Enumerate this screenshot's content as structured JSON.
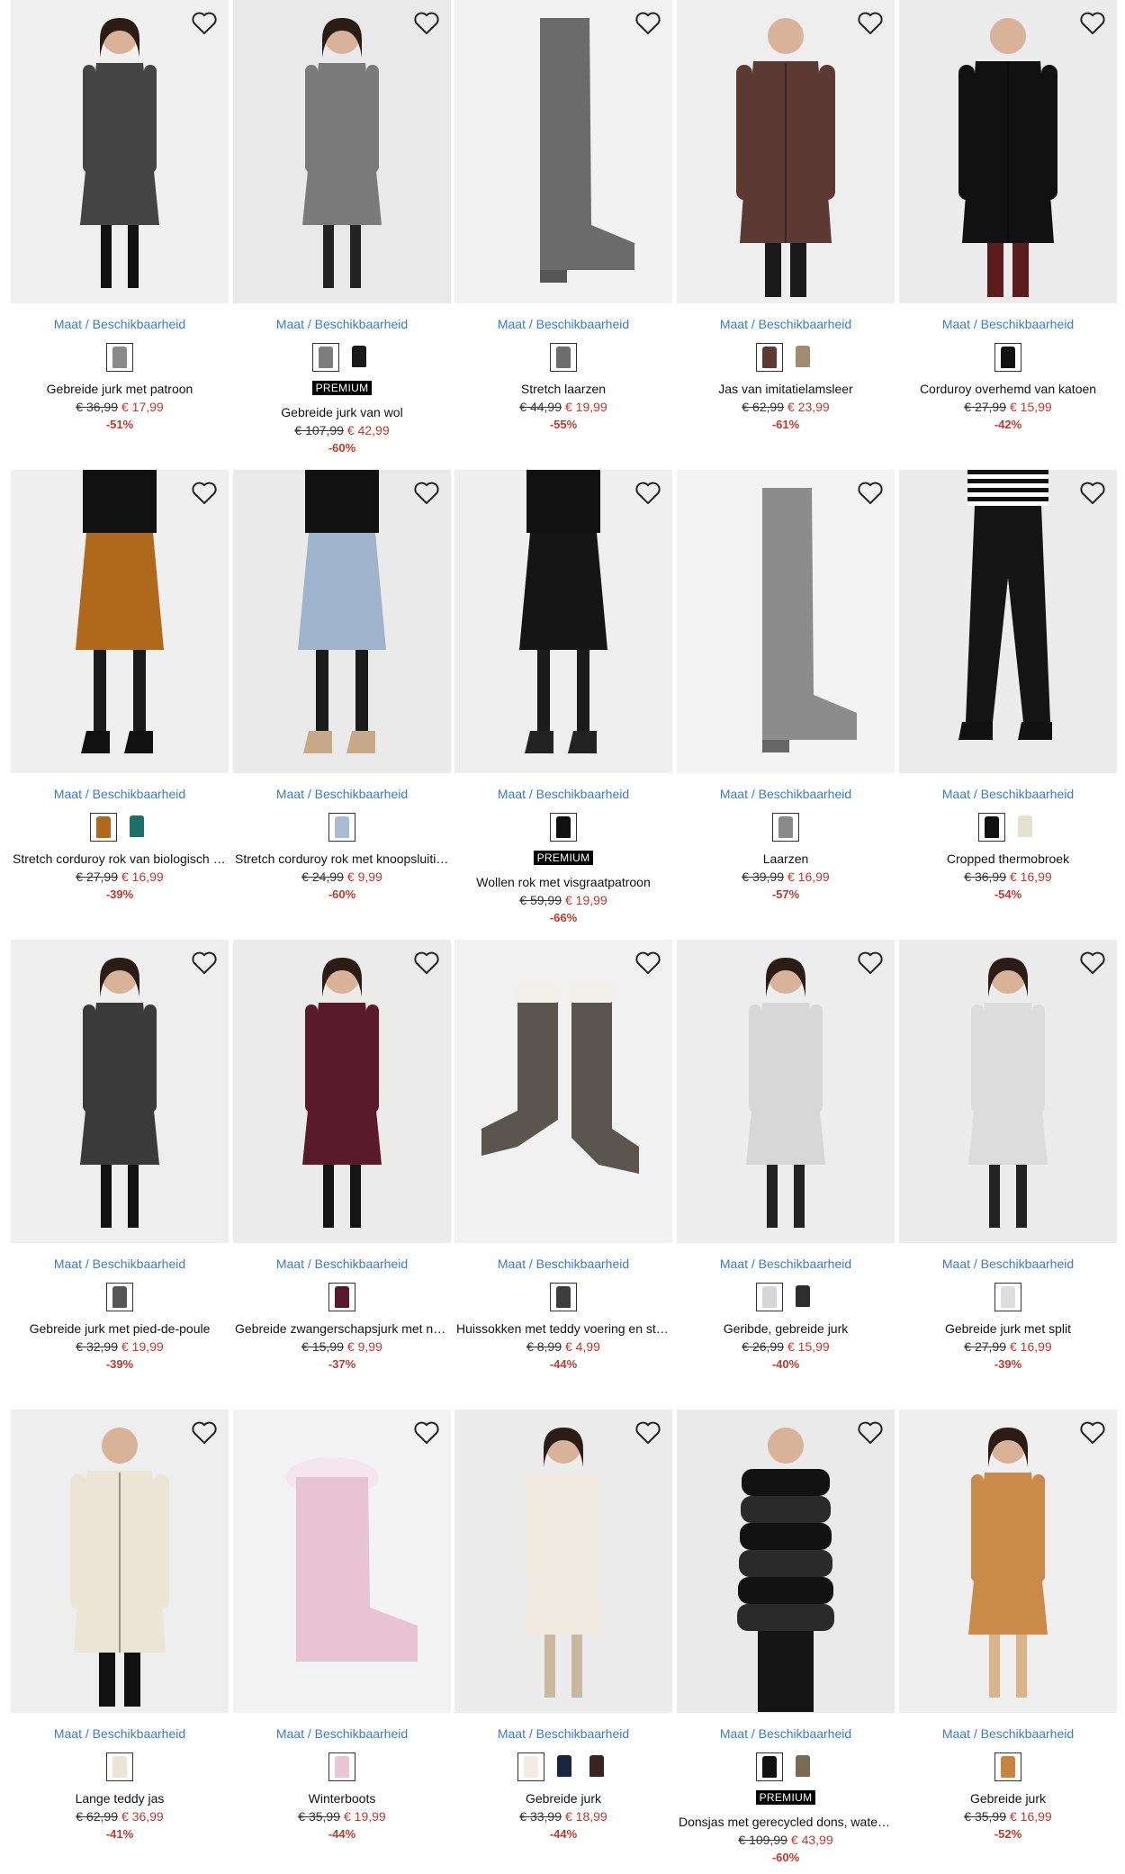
{
  "availability_label": "Maat / Beschikbaarheid",
  "badge_label": "PREMIUM",
  "products": [
    {
      "name": "Gebreide jurk met patroon",
      "old_price": "€ 36,99",
      "price": "€ 17,99",
      "discount": "-51%",
      "premium": false,
      "swatches": [
        "#8a8a8a"
      ],
      "bg": "#f0f0f0",
      "art": "dress",
      "colors": [
        "#444444",
        "#111111"
      ]
    },
    {
      "name": "Gebreide jurk van wol",
      "old_price": "€ 107,99",
      "price": "€ 42,99",
      "discount": "-60%",
      "premium": true,
      "swatches": [
        "#7d7d7d",
        "#1a1a1a"
      ],
      "bg": "#e9e9e9",
      "art": "dress",
      "colors": [
        "#7a7a7a",
        "#222222"
      ]
    },
    {
      "name": "Stretch laarzen",
      "old_price": "€ 44,99",
      "price": "€ 19,99",
      "discount": "-55%",
      "premium": false,
      "swatches": [
        "#6d6d6d"
      ],
      "bg": "#f2f2f2",
      "art": "boot",
      "colors": [
        "#6b6b6b",
        "#555555"
      ]
    },
    {
      "name": "Jas van imitatielamsleer",
      "old_price": "€ 62,99",
      "price": "€ 23,99",
      "discount": "-61%",
      "premium": false,
      "swatches": [
        "#5a3a33",
        "#a08c70"
      ],
      "bg": "#eeeeee",
      "art": "coat",
      "colors": [
        "#5a3a33",
        "#1a1a1a"
      ]
    },
    {
      "name": "Corduroy overhemd van katoen",
      "old_price": "€ 27,99",
      "price": "€ 15,99",
      "discount": "-42%",
      "premium": false,
      "swatches": [
        "#111111"
      ],
      "bg": "#ececec",
      "art": "coat",
      "colors": [
        "#111111",
        "#5a1c1c"
      ]
    },
    {
      "name": "Stretch corduroy rok van biologisch katoen",
      "old_price": "€ 27,99",
      "price": "€ 16,99",
      "discount": "-39%",
      "premium": false,
      "swatches": [
        "#b0691c",
        "#1e6e6a"
      ],
      "bg": "#efefef",
      "art": "skirt",
      "colors": [
        "#b0691c",
        "#111111"
      ]
    },
    {
      "name": "Stretch corduroy rok met knoopsluiting",
      "old_price": "€ 24,99",
      "price": "€ 9,99",
      "discount": "-60%",
      "premium": false,
      "swatches": [
        "#a9bcd3"
      ],
      "bg": "#eaeaea",
      "art": "skirt",
      "colors": [
        "#9fb4cc",
        "#c7a98a"
      ]
    },
    {
      "name": "Wollen rok met visgraatpatroon",
      "old_price": "€ 59,99",
      "price": "€ 19,99",
      "discount": "-66%",
      "premium": true,
      "swatches": [
        "#111111"
      ],
      "bg": "#efefef",
      "art": "skirt",
      "colors": [
        "#151515",
        "#222222"
      ]
    },
    {
      "name": "Laarzen",
      "old_price": "€ 39,99",
      "price": "€ 16,99",
      "discount": "-57%",
      "premium": false,
      "swatches": [
        "#8a8a8a"
      ],
      "bg": "#f3f3f3",
      "art": "boot",
      "colors": [
        "#8c8c8c",
        "#666666"
      ]
    },
    {
      "name": "Cropped thermobroek",
      "old_price": "€ 36,99",
      "price": "€ 16,99",
      "discount": "-54%",
      "premium": false,
      "swatches": [
        "#111111",
        "#e6e0cf"
      ],
      "bg": "#ececec",
      "art": "pants",
      "colors": [
        "#141414",
        "#111111"
      ]
    },
    {
      "name": "Gebreide jurk met pied-de-poule",
      "old_price": "€ 32,99",
      "price": "€ 19,99",
      "discount": "-39%",
      "premium": false,
      "swatches": [
        "#555555"
      ],
      "bg": "#eeeeee",
      "art": "dress",
      "colors": [
        "#3a3a3a",
        "#111111"
      ]
    },
    {
      "name": "Gebreide zwangerschapsjurk met noors patroon",
      "old_price": "€ 15,99",
      "price": "€ 9,99",
      "discount": "-37%",
      "premium": false,
      "swatches": [
        "#5a1a2e"
      ],
      "bg": "#ebebeb",
      "art": "dress",
      "colors": [
        "#5a1a2e",
        "#141414"
      ]
    },
    {
      "name": "Huissokken met teddy voering en stopnoppen",
      "old_price": "€ 8,99",
      "price": "€ 4,99",
      "discount": "-44%",
      "premium": false,
      "swatches": [
        "#3d3d3d"
      ],
      "bg": "#f1f1f1",
      "art": "socks",
      "colors": [
        "#5b5550",
        "#f2f0ea"
      ]
    },
    {
      "name": "Geribde, gebreide jurk",
      "old_price": "€ 26,99",
      "price": "€ 15,99",
      "discount": "-40%",
      "premium": false,
      "swatches": [
        "#d6d6d6",
        "#2e2e2e"
      ],
      "bg": "#ededed",
      "art": "dress",
      "colors": [
        "#d7d7d7",
        "#222222"
      ]
    },
    {
      "name": "Gebreide jurk met split",
      "old_price": "€ 27,99",
      "price": "€ 16,99",
      "discount": "-39%",
      "premium": false,
      "swatches": [
        "#dedede"
      ],
      "bg": "#ececec",
      "art": "dress",
      "colors": [
        "#dcdcdc",
        "#222222"
      ]
    },
    {
      "name": "Lange teddy jas",
      "old_price": "€ 62,99",
      "price": "€ 36,99",
      "discount": "-41%",
      "premium": false,
      "swatches": [
        "#ece4d4"
      ],
      "bg": "#eeeeee",
      "art": "coat",
      "colors": [
        "#ece4d4",
        "#111111"
      ]
    },
    {
      "name": "Winterboots",
      "old_price": "€ 35,99",
      "price": "€ 19,99",
      "discount": "-44%",
      "premium": false,
      "swatches": [
        "#e8c6d6"
      ],
      "bg": "#f3f3f3",
      "art": "snowboot",
      "colors": [
        "#e7c3d4",
        "#f5e6ee"
      ]
    },
    {
      "name": "Gebreide jurk",
      "old_price": "€ 33,99",
      "price": "€ 18,99",
      "discount": "-44%",
      "premium": false,
      "swatches": [
        "#f2ece2",
        "#1c2540",
        "#3a2320"
      ],
      "bg": "#ececec",
      "art": "dress",
      "colors": [
        "#f1ebe1",
        "#c9b8a0"
      ]
    },
    {
      "name": "Donsjas met gerecycled dons, waterafstotend",
      "old_price": "€ 109,99",
      "price": "€ 43,99",
      "discount": "-60%",
      "premium": true,
      "swatches": [
        "#111111",
        "#7a6a52"
      ],
      "bg": "#eaeaea",
      "art": "puffer",
      "colors": [
        "#121212",
        "#2a2a2a"
      ]
    },
    {
      "name": "Gebreide jurk",
      "old_price": "€ 35,99",
      "price": "€ 16,99",
      "discount": "-52%",
      "premium": false,
      "swatches": [
        "#c8833e"
      ],
      "bg": "#efefef",
      "art": "dress",
      "colors": [
        "#c98a4a",
        "#d8b48a"
      ]
    }
  ]
}
